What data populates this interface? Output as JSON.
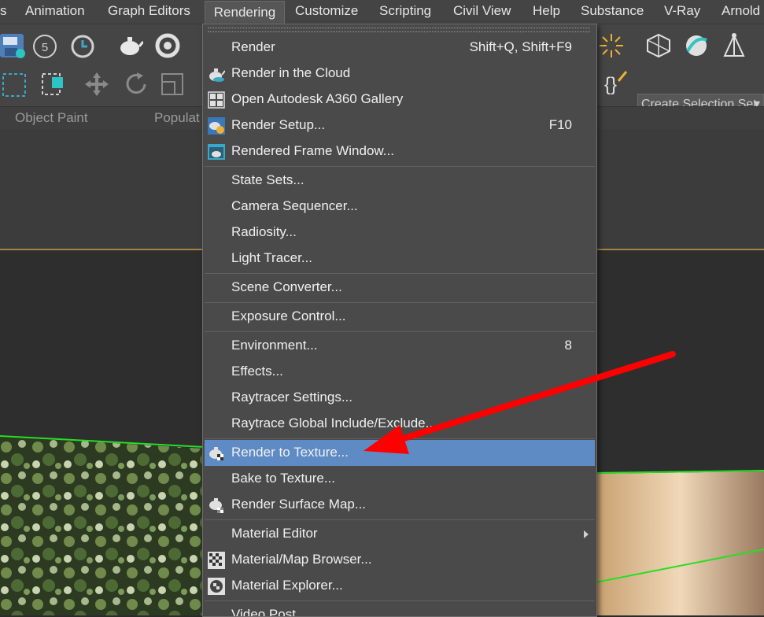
{
  "menubar": {
    "items": [
      "s",
      "Animation",
      "Graph Editors",
      "Rendering",
      "Customize",
      "Scripting",
      "Civil View",
      "Help",
      "Substance",
      "V-Ray",
      "Arnold"
    ],
    "active": "Rendering"
  },
  "toolbar": {
    "undo_count": "5",
    "selection_set_placeholder": "Create Selection Set"
  },
  "ribbon": {
    "tabs": [
      "Object Paint",
      "Populat"
    ]
  },
  "rendering_menu": {
    "items": [
      {
        "label": "Render",
        "shortcut": "Shift+Q, Shift+F9",
        "icon": ""
      },
      {
        "label": "Render in the Cloud",
        "shortcut": "",
        "icon": "teapot-cloud-icon"
      },
      {
        "label": "Open Autodesk A360 Gallery",
        "shortcut": "",
        "icon": "gallery-grid-icon"
      },
      {
        "label": "Render Setup...",
        "shortcut": "F10",
        "icon": "teapot-gear-icon"
      },
      {
        "label": "Rendered Frame Window...",
        "shortcut": "",
        "icon": "frame-window-icon"
      },
      {
        "label": "State Sets...",
        "shortcut": "",
        "icon": ""
      },
      {
        "label": "Camera Sequencer...",
        "shortcut": "",
        "icon": ""
      },
      {
        "label": "Radiosity...",
        "shortcut": "",
        "icon": ""
      },
      {
        "label": "Light Tracer...",
        "shortcut": "",
        "icon": ""
      },
      {
        "label": "Scene Converter...",
        "shortcut": "",
        "icon": ""
      },
      {
        "label": "Exposure Control...",
        "shortcut": "",
        "icon": ""
      },
      {
        "label": "Environment...",
        "shortcut": "8",
        "icon": ""
      },
      {
        "label": "Effects...",
        "shortcut": "",
        "icon": ""
      },
      {
        "label": "Raytracer Settings...",
        "shortcut": "",
        "icon": ""
      },
      {
        "label": "Raytrace Global Include/Exclude...",
        "shortcut": "",
        "icon": ""
      },
      {
        "label": "Render to Texture...",
        "shortcut": "",
        "icon": "teapot-checker-icon"
      },
      {
        "label": "Bake to Texture...",
        "shortcut": "",
        "icon": ""
      },
      {
        "label": "Render Surface Map...",
        "shortcut": "",
        "icon": "teapot-surface-icon"
      },
      {
        "label": "Material Editor",
        "shortcut": "",
        "icon": "submenu-arrow-icon"
      },
      {
        "label": "Material/Map Browser...",
        "shortcut": "",
        "icon": "checker-browser-icon"
      },
      {
        "label": "Material Explorer...",
        "shortcut": "",
        "icon": "checker-sphere-icon"
      },
      {
        "label": "Video Post...",
        "shortcut": "",
        "icon": ""
      }
    ],
    "highlighted": "Render to Texture..."
  },
  "colors": {
    "menu_bg": "#4a4a4a",
    "highlight": "#5f8bc4",
    "annotation_arrow": "#ff0000",
    "viewport_line": "#22e022"
  }
}
